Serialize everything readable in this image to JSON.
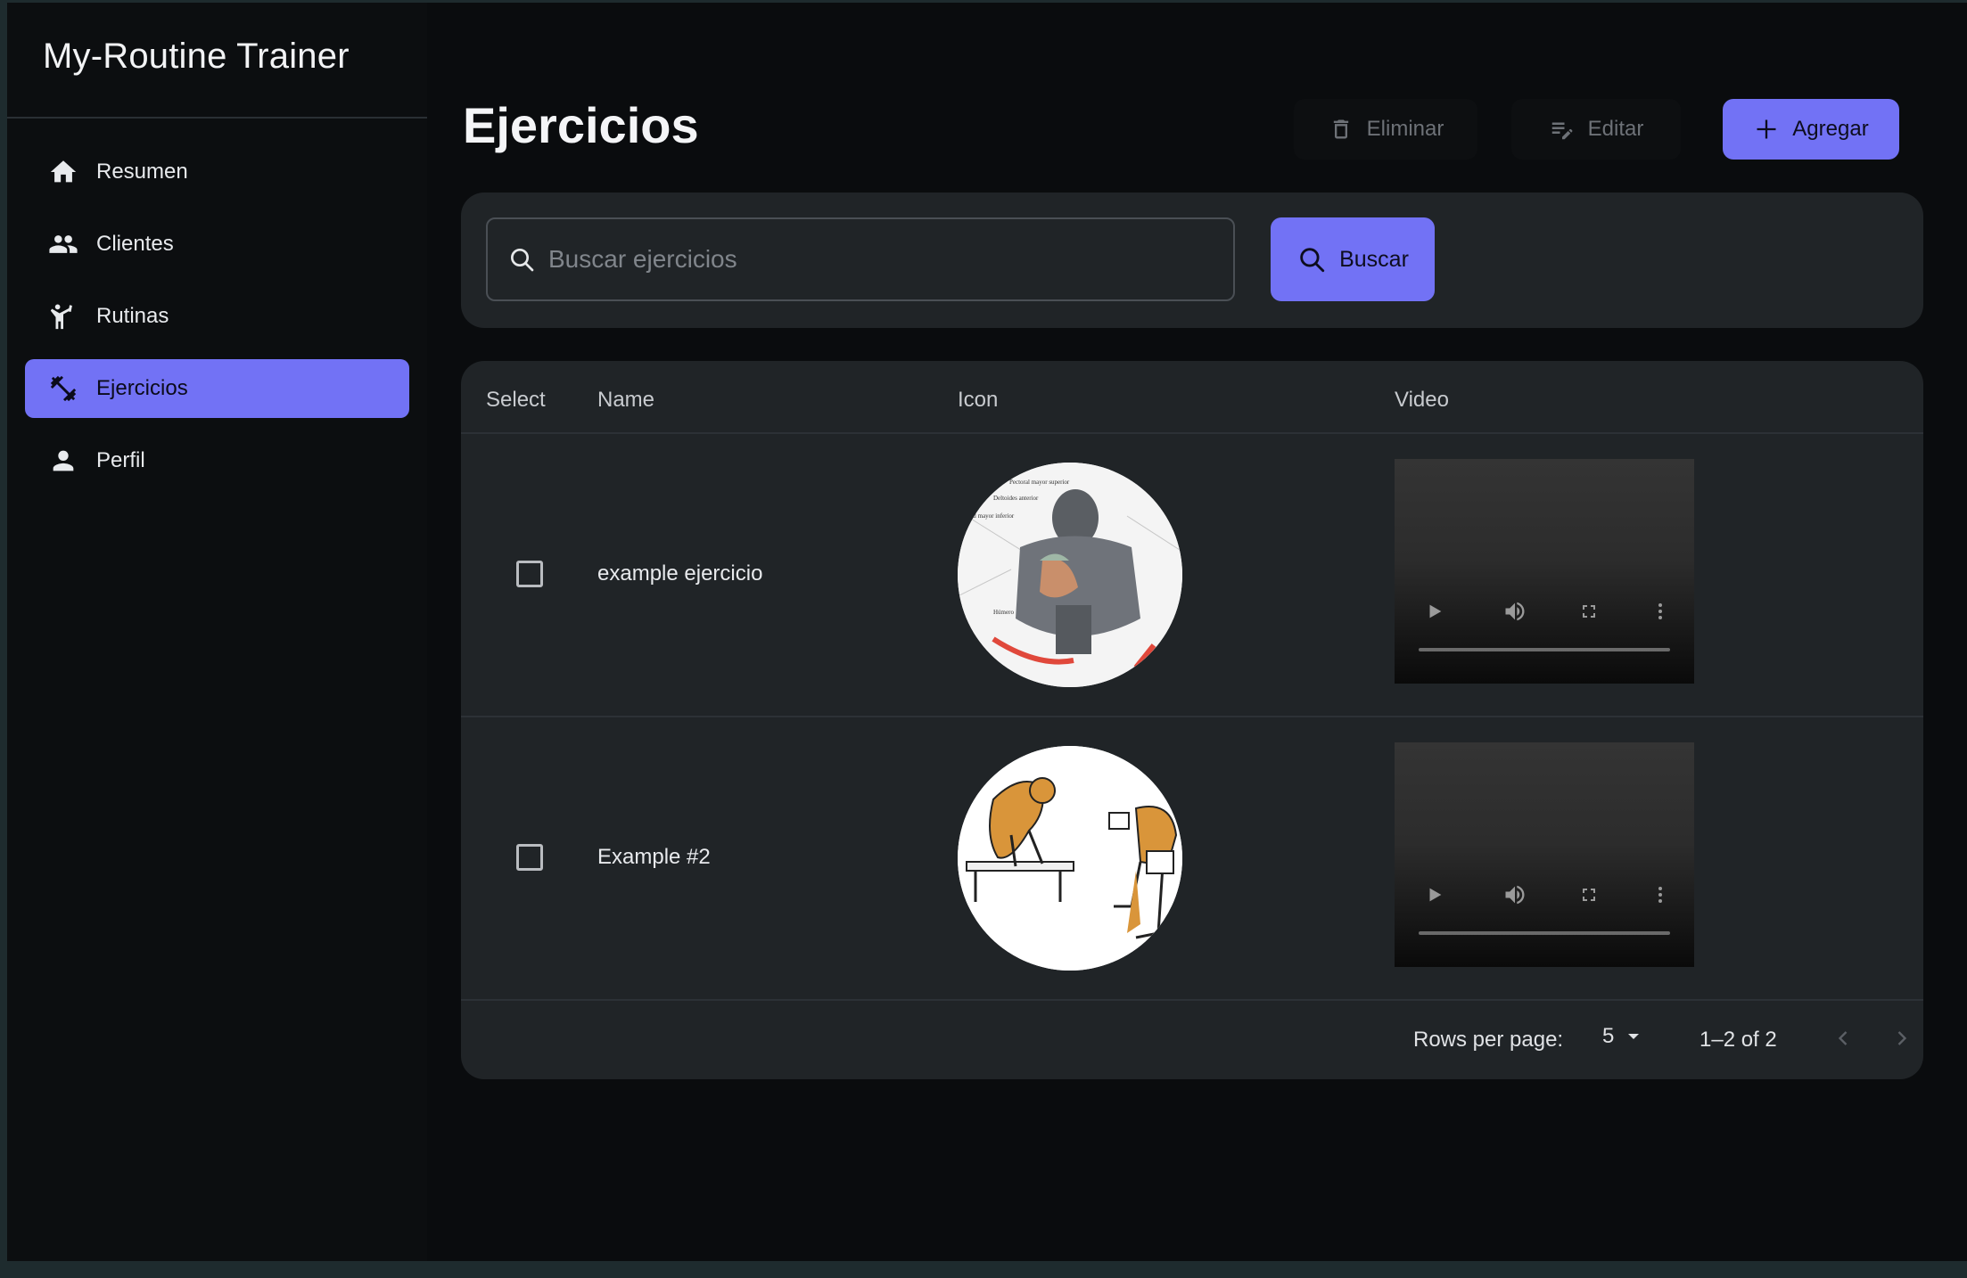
{
  "app": {
    "title": "My-Routine Trainer"
  },
  "sidebar": {
    "items": [
      {
        "label": "Resumen",
        "icon": "home-icon",
        "active": false
      },
      {
        "label": "Clientes",
        "icon": "people-icon",
        "active": false
      },
      {
        "label": "Rutinas",
        "icon": "gymnastics-icon",
        "active": false
      },
      {
        "label": "Ejercicios",
        "icon": "dumbbell-icon",
        "active": true
      },
      {
        "label": "Perfil",
        "icon": "person-icon",
        "active": false
      }
    ]
  },
  "header": {
    "title": "Ejercicios",
    "delete_label": "Eliminar",
    "edit_label": "Editar",
    "add_label": "Agregar"
  },
  "search": {
    "placeholder": "Buscar ejercicios",
    "value": "",
    "button_label": "Buscar"
  },
  "table": {
    "columns": [
      "Select",
      "Name",
      "Icon",
      "Video"
    ],
    "rows": [
      {
        "name": "example ejercicio",
        "selected": false,
        "icon": "chest-muscle-illustration"
      },
      {
        "name": "Example #2",
        "selected": false,
        "icon": "dumbbell-row-illustration"
      }
    ]
  },
  "pagination": {
    "rows_per_page_label": "Rows per page:",
    "rows_per_page": "5",
    "range": "1–2 of 2"
  },
  "colors": {
    "accent": "#7272f5",
    "background": "#0a0c0e",
    "card": "#202427"
  }
}
